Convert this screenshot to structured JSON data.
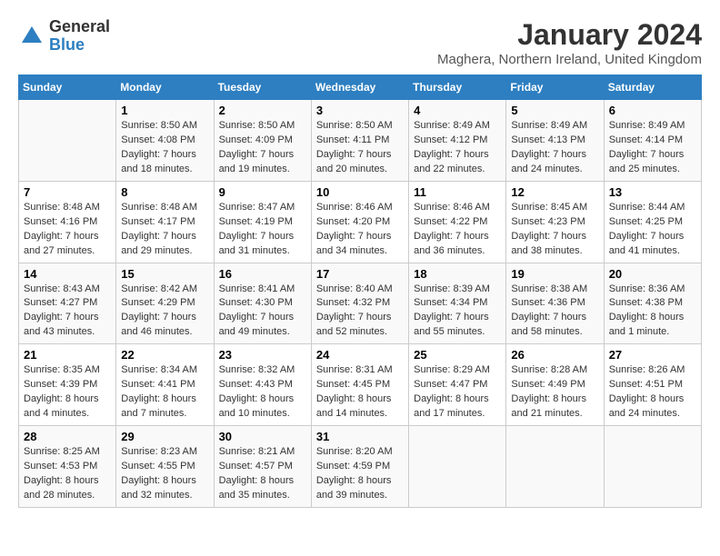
{
  "header": {
    "logo_general": "General",
    "logo_blue": "Blue",
    "month_title": "January 2024",
    "location": "Maghera, Northern Ireland, United Kingdom"
  },
  "days_of_week": [
    "Sunday",
    "Monday",
    "Tuesday",
    "Wednesday",
    "Thursday",
    "Friday",
    "Saturday"
  ],
  "weeks": [
    [
      {
        "day": "",
        "info": ""
      },
      {
        "day": "1",
        "info": "Sunrise: 8:50 AM\nSunset: 4:08 PM\nDaylight: 7 hours\nand 18 minutes."
      },
      {
        "day": "2",
        "info": "Sunrise: 8:50 AM\nSunset: 4:09 PM\nDaylight: 7 hours\nand 19 minutes."
      },
      {
        "day": "3",
        "info": "Sunrise: 8:50 AM\nSunset: 4:11 PM\nDaylight: 7 hours\nand 20 minutes."
      },
      {
        "day": "4",
        "info": "Sunrise: 8:49 AM\nSunset: 4:12 PM\nDaylight: 7 hours\nand 22 minutes."
      },
      {
        "day": "5",
        "info": "Sunrise: 8:49 AM\nSunset: 4:13 PM\nDaylight: 7 hours\nand 24 minutes."
      },
      {
        "day": "6",
        "info": "Sunrise: 8:49 AM\nSunset: 4:14 PM\nDaylight: 7 hours\nand 25 minutes."
      }
    ],
    [
      {
        "day": "7",
        "info": "Sunrise: 8:48 AM\nSunset: 4:16 PM\nDaylight: 7 hours\nand 27 minutes."
      },
      {
        "day": "8",
        "info": "Sunrise: 8:48 AM\nSunset: 4:17 PM\nDaylight: 7 hours\nand 29 minutes."
      },
      {
        "day": "9",
        "info": "Sunrise: 8:47 AM\nSunset: 4:19 PM\nDaylight: 7 hours\nand 31 minutes."
      },
      {
        "day": "10",
        "info": "Sunrise: 8:46 AM\nSunset: 4:20 PM\nDaylight: 7 hours\nand 34 minutes."
      },
      {
        "day": "11",
        "info": "Sunrise: 8:46 AM\nSunset: 4:22 PM\nDaylight: 7 hours\nand 36 minutes."
      },
      {
        "day": "12",
        "info": "Sunrise: 8:45 AM\nSunset: 4:23 PM\nDaylight: 7 hours\nand 38 minutes."
      },
      {
        "day": "13",
        "info": "Sunrise: 8:44 AM\nSunset: 4:25 PM\nDaylight: 7 hours\nand 41 minutes."
      }
    ],
    [
      {
        "day": "14",
        "info": "Sunrise: 8:43 AM\nSunset: 4:27 PM\nDaylight: 7 hours\nand 43 minutes."
      },
      {
        "day": "15",
        "info": "Sunrise: 8:42 AM\nSunset: 4:29 PM\nDaylight: 7 hours\nand 46 minutes."
      },
      {
        "day": "16",
        "info": "Sunrise: 8:41 AM\nSunset: 4:30 PM\nDaylight: 7 hours\nand 49 minutes."
      },
      {
        "day": "17",
        "info": "Sunrise: 8:40 AM\nSunset: 4:32 PM\nDaylight: 7 hours\nand 52 minutes."
      },
      {
        "day": "18",
        "info": "Sunrise: 8:39 AM\nSunset: 4:34 PM\nDaylight: 7 hours\nand 55 minutes."
      },
      {
        "day": "19",
        "info": "Sunrise: 8:38 AM\nSunset: 4:36 PM\nDaylight: 7 hours\nand 58 minutes."
      },
      {
        "day": "20",
        "info": "Sunrise: 8:36 AM\nSunset: 4:38 PM\nDaylight: 8 hours\nand 1 minute."
      }
    ],
    [
      {
        "day": "21",
        "info": "Sunrise: 8:35 AM\nSunset: 4:39 PM\nDaylight: 8 hours\nand 4 minutes."
      },
      {
        "day": "22",
        "info": "Sunrise: 8:34 AM\nSunset: 4:41 PM\nDaylight: 8 hours\nand 7 minutes."
      },
      {
        "day": "23",
        "info": "Sunrise: 8:32 AM\nSunset: 4:43 PM\nDaylight: 8 hours\nand 10 minutes."
      },
      {
        "day": "24",
        "info": "Sunrise: 8:31 AM\nSunset: 4:45 PM\nDaylight: 8 hours\nand 14 minutes."
      },
      {
        "day": "25",
        "info": "Sunrise: 8:29 AM\nSunset: 4:47 PM\nDaylight: 8 hours\nand 17 minutes."
      },
      {
        "day": "26",
        "info": "Sunrise: 8:28 AM\nSunset: 4:49 PM\nDaylight: 8 hours\nand 21 minutes."
      },
      {
        "day": "27",
        "info": "Sunrise: 8:26 AM\nSunset: 4:51 PM\nDaylight: 8 hours\nand 24 minutes."
      }
    ],
    [
      {
        "day": "28",
        "info": "Sunrise: 8:25 AM\nSunset: 4:53 PM\nDaylight: 8 hours\nand 28 minutes."
      },
      {
        "day": "29",
        "info": "Sunrise: 8:23 AM\nSunset: 4:55 PM\nDaylight: 8 hours\nand 32 minutes."
      },
      {
        "day": "30",
        "info": "Sunrise: 8:21 AM\nSunset: 4:57 PM\nDaylight: 8 hours\nand 35 minutes."
      },
      {
        "day": "31",
        "info": "Sunrise: 8:20 AM\nSunset: 4:59 PM\nDaylight: 8 hours\nand 39 minutes."
      },
      {
        "day": "",
        "info": ""
      },
      {
        "day": "",
        "info": ""
      },
      {
        "day": "",
        "info": ""
      }
    ]
  ]
}
